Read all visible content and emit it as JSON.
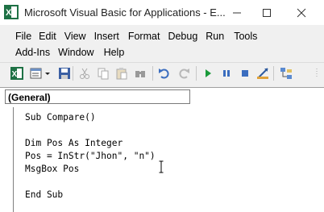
{
  "window": {
    "title": "Microsoft Visual Basic for Applications - E...",
    "minimize_icon": "minimize-icon",
    "maximize_icon": "maximize-icon",
    "close_icon": "close-icon"
  },
  "menu": {
    "row1": [
      "File",
      "Edit",
      "View",
      "Insert",
      "Format",
      "Debug",
      "Run",
      "Tools"
    ],
    "row2": [
      "Add-Ins",
      "Window",
      "Help"
    ]
  },
  "toolbar": {
    "icons": [
      "excel-icon",
      "insert-module-icon",
      "dropdown-icon",
      "save-icon",
      "cut-icon",
      "copy-icon",
      "paste-icon",
      "find-icon",
      "undo-icon",
      "redo-icon",
      "run-icon",
      "break-icon",
      "reset-icon",
      "design-mode-icon",
      "project-explorer-icon"
    ]
  },
  "code_window": {
    "object_combo": "(General)",
    "lines": [
      "Sub Compare()",
      "",
      "Dim Pos As Integer",
      "Pos = InStr(\"Jhon\", \"n\")",
      "MsgBox Pos",
      "",
      "End Sub"
    ]
  }
}
